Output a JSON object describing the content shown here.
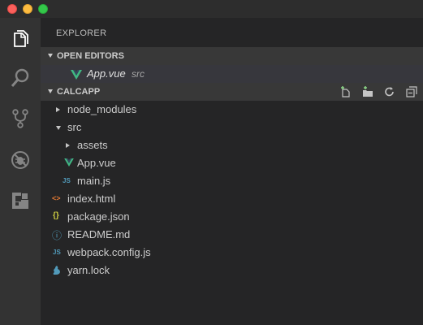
{
  "window": {
    "controls": [
      "close",
      "minimize",
      "maximize"
    ]
  },
  "activity_bar": {
    "icons": [
      "files-icon",
      "search-icon",
      "source-control-icon",
      "debug-icon",
      "extensions-icon"
    ]
  },
  "explorer": {
    "title": "EXPLORER",
    "open_editors": {
      "header": "OPEN EDITORS",
      "items": [
        {
          "name": "App.vue",
          "description": "src",
          "icon": "vue-icon"
        }
      ]
    },
    "project": {
      "header": "CALCAPP",
      "actions": [
        "new-file-icon",
        "new-folder-icon",
        "refresh-icon",
        "collapse-all-icon"
      ],
      "tree": [
        {
          "name": "node_modules",
          "type": "folder",
          "expanded": false,
          "icon_glyph": "",
          "icon": ""
        },
        {
          "name": "src",
          "type": "folder",
          "expanded": true,
          "icon_glyph": "",
          "icon": ""
        },
        {
          "name": "assets",
          "type": "folder",
          "expanded": false,
          "icon_glyph": "",
          "icon": ""
        },
        {
          "name": "App.vue",
          "type": "file",
          "icon_glyph": "",
          "icon": "vue-icon"
        },
        {
          "name": "main.js",
          "type": "file",
          "icon_glyph": "JS",
          "icon": "js-icon"
        },
        {
          "name": "index.html",
          "type": "file",
          "icon_glyph": "<>",
          "icon": "html-icon"
        },
        {
          "name": "package.json",
          "type": "file",
          "icon_glyph": "{}",
          "icon": "json-icon"
        },
        {
          "name": "README.md",
          "type": "file",
          "icon_glyph": "ⓘ",
          "icon": "info-icon"
        },
        {
          "name": "webpack.config.js",
          "type": "file",
          "icon_glyph": "JS",
          "icon": "js-icon"
        },
        {
          "name": "yarn.lock",
          "type": "file",
          "icon_glyph": "",
          "icon": "yarn-icon"
        }
      ]
    }
  },
  "colors": {
    "vue_green": "#41b883",
    "js_blue": "#519aba",
    "html_orange": "#e37933",
    "json_yellow": "#cbcb41",
    "info_blue": "#519aba",
    "yarn_blue": "#519aba"
  }
}
